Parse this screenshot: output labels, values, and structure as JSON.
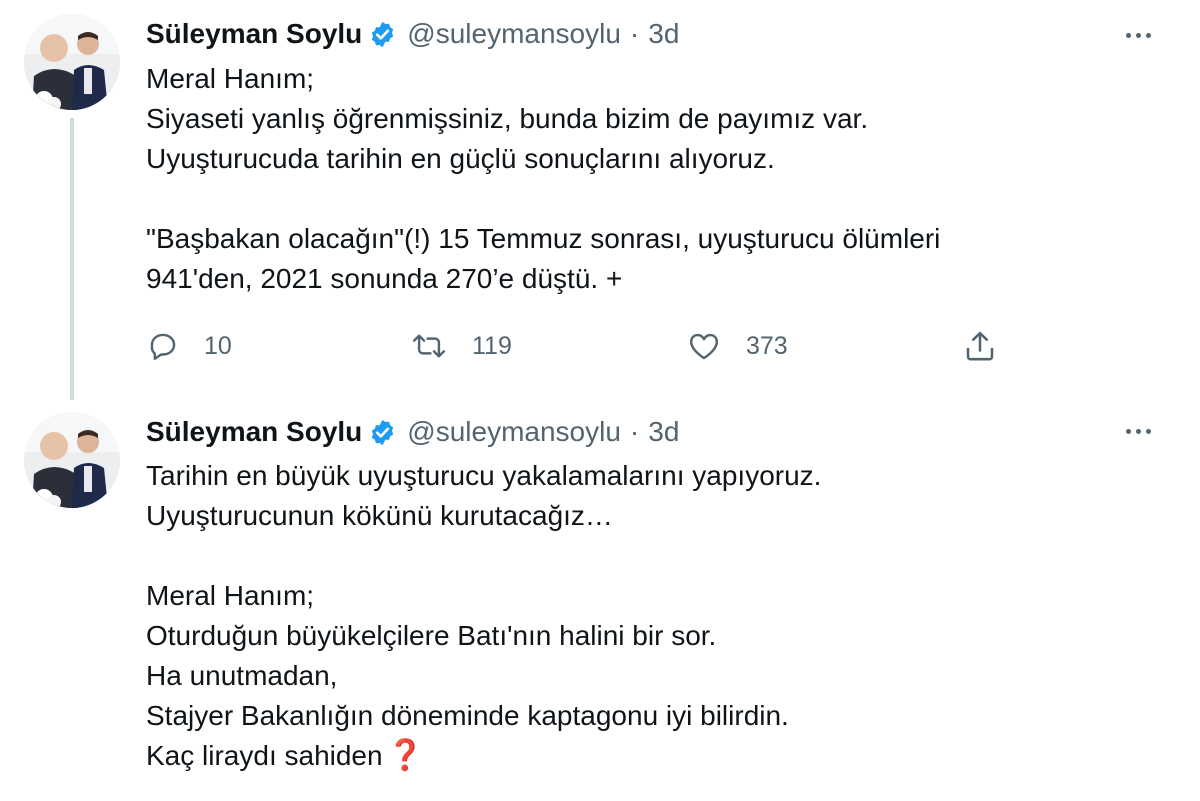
{
  "tweets": [
    {
      "author_name": "Süleyman Soylu",
      "handle": "@suleymansoylu",
      "separator": "·",
      "time": "3d",
      "lines": [
        "Meral Hanım;",
        "Siyaseti yanlış öğrenmişsiniz, bunda bizim de payımız var.",
        "Uyuşturucuda tarihin en güçlü sonuçlarını alıyoruz.",
        "",
        "\"Başbakan olacağın\"(!) 15 Temmuz sonrası, uyuşturucu ölümleri",
        "941'den, 2021 sonunda 270’e düştü. +"
      ],
      "reply_count": "10",
      "retweet_count": "119",
      "like_count": "373",
      "icons": {
        "avatar": "profile-photo",
        "verified": "verified-badge-icon",
        "more": "more-dots-icon",
        "reply": "reply-icon",
        "retweet": "retweet-icon",
        "like": "heart-icon",
        "share": "share-icon"
      }
    },
    {
      "author_name": "Süleyman Soylu",
      "handle": "@suleymansoylu",
      "separator": "·",
      "time": "3d",
      "lines": [
        "Tarihin en büyük uyuşturucu yakalamalarını yapıyoruz.",
        "Uyuşturucunun kökünü kurutacağız…",
        "",
        "Meral Hanım;",
        "Oturduğun büyükelçilere Batı'nın halini bir sor.",
        "Ha unutmadan,",
        "Stajyer Bakanlığın döneminde kaptagonu iyi bilirdin.",
        "Kaç liraydı sahiden"
      ],
      "emoji": "❓"
    }
  ],
  "colors": {
    "text": "#0f1419",
    "secondary": "#536471",
    "verified": "#1d9bf0",
    "thread_line": "#cfd9de",
    "emoji": "#d0021b"
  }
}
